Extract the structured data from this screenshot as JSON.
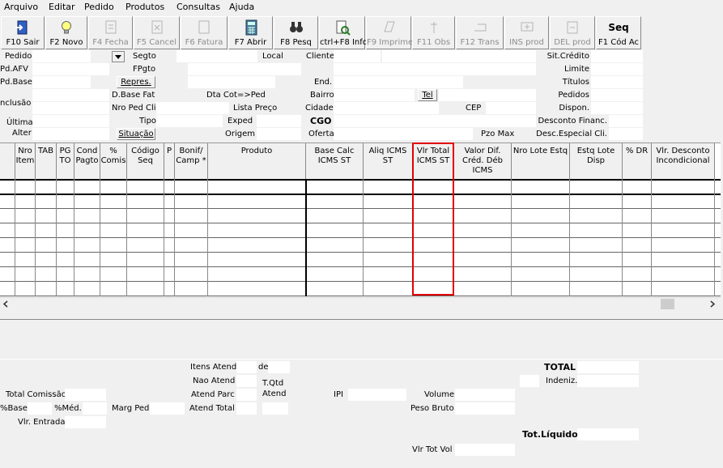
{
  "menu": [
    "Arquivo",
    "Editar",
    "Pedido",
    "Produtos",
    "Consultas",
    "Ajuda"
  ],
  "toolbar": {
    "buttons": [
      {
        "label": "F10 Sair",
        "icon": "exit-door-icon",
        "enabled": true
      },
      {
        "label": "F2 Novo",
        "icon": "lightbulb-icon",
        "enabled": true
      },
      {
        "label": "F4 Fecha",
        "icon": "document-close-icon",
        "enabled": false
      },
      {
        "label": "F5 Cancel",
        "icon": "document-cancel-icon",
        "enabled": false
      },
      {
        "label": "F6 Fatura",
        "icon": "invoice-icon",
        "enabled": false
      },
      {
        "label": "F7 Abrir",
        "icon": "calculator-icon",
        "enabled": true
      },
      {
        "label": "F8 Pesq",
        "icon": "binoculars-icon",
        "enabled": true
      },
      {
        "label": "ctrl+F8 Info",
        "icon": "document-search-icon",
        "enabled": true
      },
      {
        "label": "F9 Imprime",
        "icon": "printer-icon",
        "enabled": false
      },
      {
        "label": "F11 Obs",
        "icon": "notes-icon",
        "enabled": false
      },
      {
        "label": "F12 Trans",
        "icon": "transfer-icon",
        "enabled": false
      },
      {
        "label": "INS prod",
        "icon": "insert-product-icon",
        "enabled": false
      },
      {
        "label": "DEL prod",
        "icon": "delete-product-icon",
        "enabled": false
      },
      {
        "label": "F1 Cód Ac",
        "title": "Seq",
        "icon": "",
        "enabled": true
      }
    ]
  },
  "form": {
    "pedido": "Pedido",
    "pd_afv": "Pd.AFV",
    "pd_base": "Pd.Base",
    "inclusao": "nclusão",
    "ultima": "Última",
    "alter": "Alter",
    "segto": "Segto",
    "fpgto": "FPgto",
    "repres": "Repres.",
    "d_base_fat": "D.Base Fat",
    "nro_ped_cli": "Nro Ped Cli",
    "tipo": "Tipo",
    "situacao": "Situação",
    "local": "Local",
    "dta_cot_ped": "Dta Cot=>Ped",
    "lista_preco": "Lista Preço",
    "exped": "Exped",
    "origem": "Origem",
    "cliente": "Cliente",
    "end": "End.",
    "bairro": "Bairro",
    "cidade": "Cidade",
    "cgo": "CGO",
    "oferta": "Oferta",
    "tel": "Tel",
    "cep": "CEP",
    "pzo_max": "Pzo Max",
    "sit_credito": "Sit.Crédito",
    "limite": "Limite",
    "titulos": "Títulos",
    "pedidos": "Pedidos",
    "dispon": "Dispon.",
    "desconto_financ": "Desconto Financ.",
    "desc_especial_cli": "Desc.Especial Cli."
  },
  "grid": {
    "columns": [
      "Nro Item",
      "TAB",
      "PG TO",
      "Cond Pagto",
      "% Comis",
      "Código Seq",
      "P",
      "Bonif/ Camp *",
      "Produto",
      "Base Calc ICMS ST",
      "Aliq ICMS ST",
      "Vlr Total ICMS ST",
      "Valor Dif. Créd. Déb ICMS",
      "Nro Lote Estq",
      "Estq Lote Disp",
      "% DR",
      "Vlr. Desconto Incondicional"
    ],
    "highlighted_column": "Vlr Total ICMS ST",
    "highlight_color": "#e00000"
  },
  "totals": {
    "itens_atend": "Itens Atend",
    "de": "de",
    "nao_atend": "Nao Atend",
    "t_qtd_atend": "T.Qtd Atend",
    "atend_parc": "Atend Parc",
    "atend_total": "Atend Total",
    "total_comissao": "Total Comissão",
    "pct_base": "%Base",
    "pct_med": "%Méd.",
    "marg_ped": "Marg Ped",
    "vlr_entrada": "Vlr. Entrada",
    "ipi": "IPI",
    "volume": "Volume",
    "peso_bruto": "Peso Bruto",
    "vlr_tot_vol": "Vlr Tot Vol",
    "total": "TOTAL",
    "indeniz": "Indeniz.",
    "tot_liquido": "Tot.Líquido"
  }
}
